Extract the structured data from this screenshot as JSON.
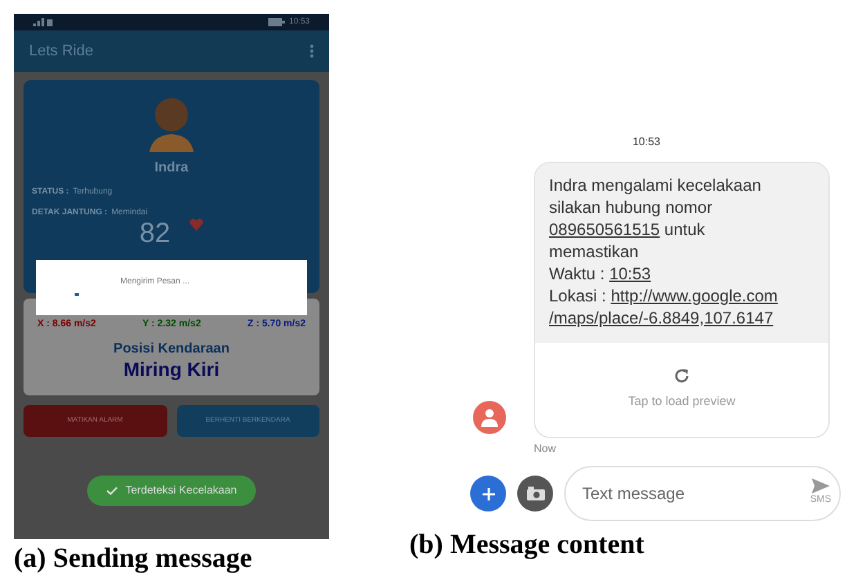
{
  "sending_screen": {
    "status_time": "10:53",
    "app_title": "Lets Ride",
    "profile": {
      "name": "Indra",
      "status_label": "STATUS :",
      "status_value": "Terhubung",
      "heart_label": "DETAK JANTUNG :",
      "heart_value": "Memindai",
      "heart_rate": "82"
    },
    "acceleration": [
      {
        "text": "X : 8.66 m/s2",
        "color": "#7a0000"
      },
      {
        "text": "Y : 2.32 m/s2",
        "color": "#004d00"
      },
      {
        "text": "Z : 5.70 m/s2",
        "color": "#0a1a80"
      }
    ],
    "position_label": "Posisi Kendaraan",
    "position_value": "Miring Kiri",
    "buttons": [
      {
        "label": "MATIKAN ALARM",
        "kind": "danger"
      },
      {
        "label": "BERHENTI BERKENDARA",
        "kind": "primary"
      }
    ],
    "dialog": {
      "message": "Mengirim Pesan ..."
    },
    "toast": "Terdeteksi Kecelakaan"
  },
  "message_screen": {
    "timestamp": "10:53",
    "message": {
      "lines": [
        {
          "text": "Indra mengalami kecelakaan"
        },
        {
          "text": "silakan hubung nomor"
        },
        {
          "link": "089650561515",
          "text": " untuk"
        },
        {
          "text": "memastikan"
        },
        {
          "text": "Waktu : ",
          "link": "10:53"
        },
        {
          "text": "Lokasi : ",
          "link": "http://www.google.com"
        },
        {
          "link": "/maps/place/-6.8849,107.6147"
        }
      ],
      "preview_label": "Tap to load preview",
      "sent": "Now"
    },
    "composer": {
      "placeholder": "Text message",
      "send_label": "SMS"
    }
  },
  "captions": [
    "(a) Sending message",
    "(b) Message content"
  ]
}
